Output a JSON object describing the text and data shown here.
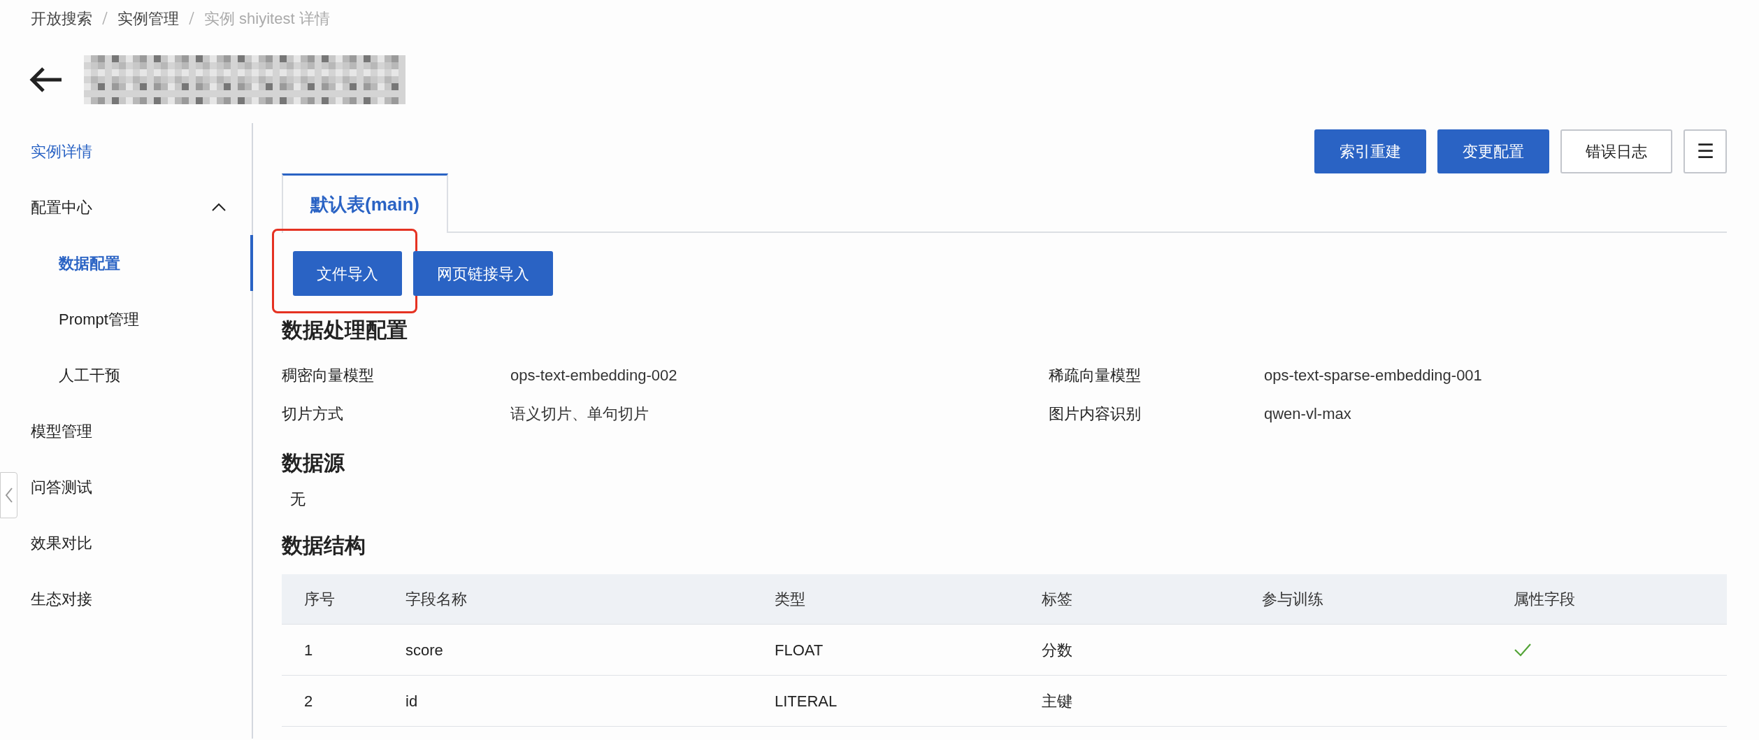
{
  "breadcrumb": [
    "开放搜索",
    "实例管理",
    "实例 shiyitest 详情"
  ],
  "sidebar": {
    "items": [
      {
        "label": "实例详情",
        "selected": false,
        "current_page": true
      },
      {
        "label": "配置中心",
        "selected": false,
        "expanded": true,
        "children": [
          {
            "label": "数据配置",
            "selected": true
          },
          {
            "label": "Prompt管理",
            "selected": false
          },
          {
            "label": "人工干预",
            "selected": false
          }
        ]
      },
      {
        "label": "模型管理",
        "selected": false
      },
      {
        "label": "问答测试",
        "selected": false
      },
      {
        "label": "效果对比",
        "selected": false
      },
      {
        "label": "生态对接",
        "selected": false
      }
    ]
  },
  "toolbar": [
    {
      "label": "索引重建",
      "kind": "primary"
    },
    {
      "label": "变更配置",
      "kind": "primary"
    },
    {
      "label": "错误日志",
      "kind": "outline"
    },
    {
      "label": "☰",
      "kind": "outline"
    }
  ],
  "tabs": [
    {
      "label": "默认表(main)",
      "selected": true
    }
  ],
  "import_buttons": [
    {
      "label": "文件导入",
      "highlighted": true
    },
    {
      "label": "网页链接导入",
      "highlighted": false
    }
  ],
  "processing": {
    "title": "数据处理配置",
    "fields": [
      {
        "label": "稠密向量模型",
        "value": "ops-text-embedding-002"
      },
      {
        "label": "稀疏向量模型",
        "value": "ops-text-sparse-embedding-001"
      },
      {
        "label": "切片方式",
        "value": "语义切片、单句切片"
      },
      {
        "label": "图片内容识别",
        "value": "qwen-vl-max"
      }
    ]
  },
  "data_source": {
    "title": "数据源",
    "value": "无"
  },
  "schema": {
    "title": "数据结构",
    "columns": [
      "序号",
      "字段名称",
      "类型",
      "标签",
      "参与训练",
      "属性字段"
    ],
    "rows": [
      {
        "index": "1",
        "name": "score",
        "type": "FLOAT",
        "tag": "分数",
        "training": false,
        "attribute": true
      },
      {
        "index": "2",
        "name": "id",
        "type": "LITERAL",
        "tag": "主键",
        "training": false,
        "attribute": false
      }
    ]
  }
}
